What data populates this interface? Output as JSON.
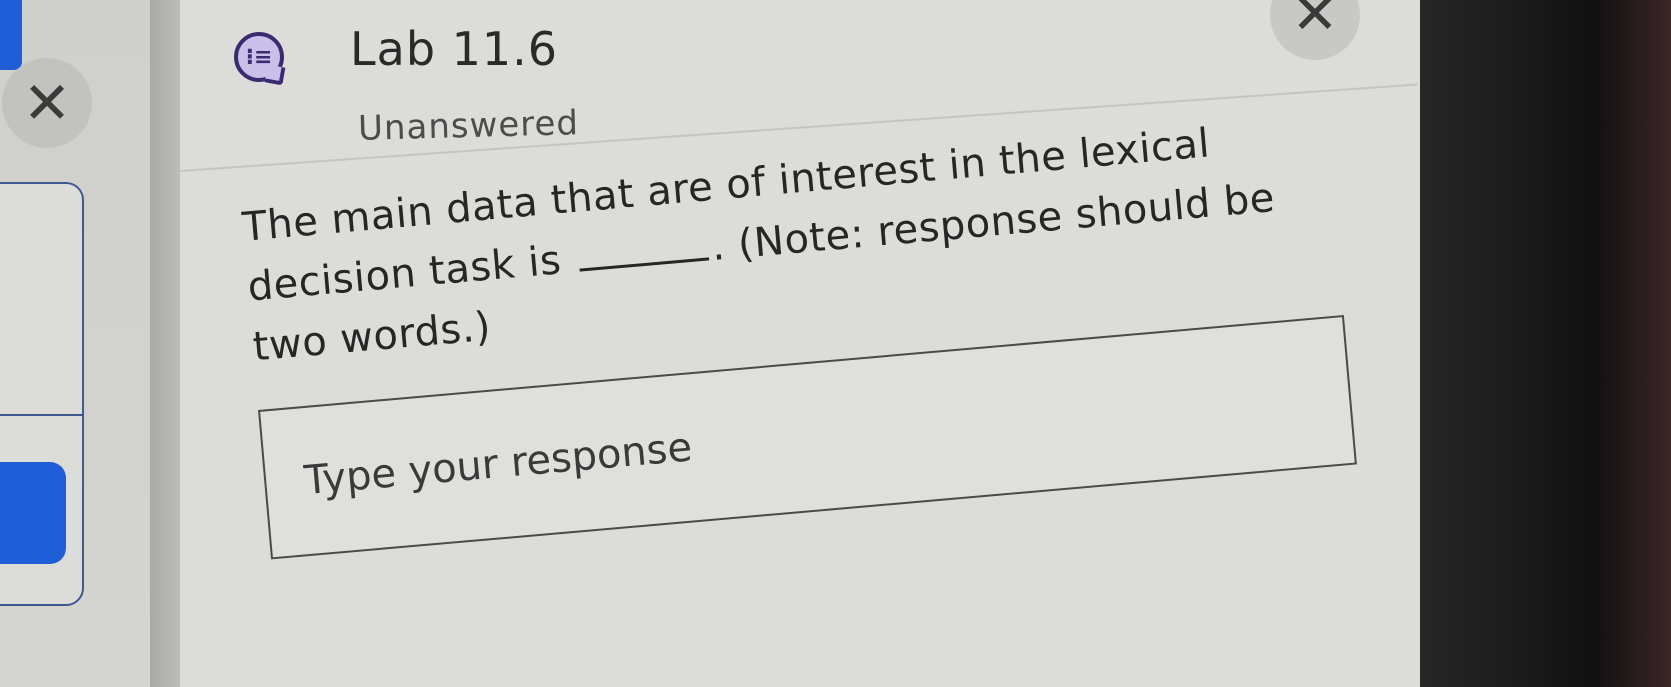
{
  "left_panel": {
    "close_glyph": "✕"
  },
  "header": {
    "icon": "question-list-icon",
    "icon_glyph": "⁝≡",
    "title": "Lab 11.6",
    "status": "Unanswered",
    "close_glyph": "✕"
  },
  "question": {
    "text_before": "The main data that are of interest in the lexical decision task is",
    "text_after": ". (Note: response should be two words.)"
  },
  "response": {
    "placeholder": "Type your response",
    "value": ""
  },
  "colors": {
    "accent_blue": "#1f5ed6",
    "icon_purple": "#c9bfe9",
    "icon_stroke": "#3b2b6e"
  }
}
